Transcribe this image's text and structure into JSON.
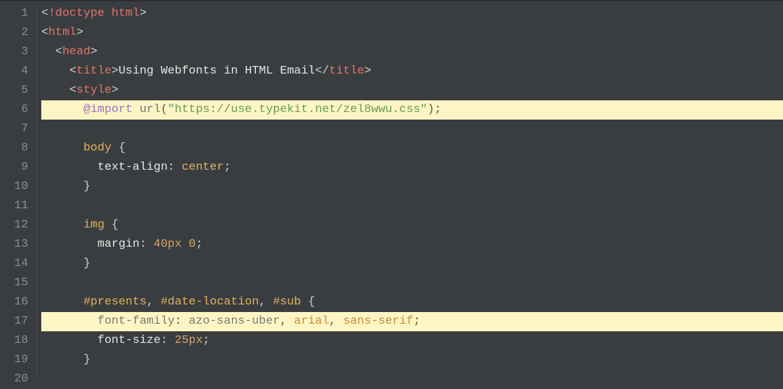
{
  "gutter": {
    "lines": [
      "1",
      "2",
      "3",
      "4",
      "5",
      "6",
      "7",
      "8",
      "9",
      "10",
      "11",
      "12",
      "13",
      "14",
      "15",
      "16",
      "17",
      "18",
      "19",
      "20"
    ]
  },
  "code": {
    "l1": {
      "doctype": "!doctype html"
    },
    "l2": {
      "tag": "html"
    },
    "l3": {
      "tag": "head"
    },
    "l4": {
      "tag_open": "title",
      "text": "Using Webfonts in HTML Email",
      "tag_close": "title"
    },
    "l5": {
      "tag": "style"
    },
    "l6": {
      "keyword": "@import",
      "func": "url",
      "string": "\"https://use.typekit.net/zel8wwu.css\"",
      "semi": ";"
    },
    "l7": {},
    "l8": {
      "selector": "body",
      "brace": "{"
    },
    "l9": {
      "prop": "text-align",
      "value": "center",
      "semi": ";"
    },
    "l10": {
      "brace": "}"
    },
    "l11": {},
    "l12": {
      "selector": "img",
      "brace": "{"
    },
    "l13": {
      "prop": "margin",
      "val1": "40px",
      "val2": "0",
      "semi": ";"
    },
    "l14": {
      "brace": "}"
    },
    "l15": {},
    "l16": {
      "sel1": "#presents",
      "sel2": "#date-location",
      "sel3": "#sub",
      "brace": "{"
    },
    "l17": {
      "prop": "font-family",
      "val1": "azo-sans-uber",
      "val2": "arial",
      "val3": "sans-serif",
      "semi": ";"
    },
    "l18": {
      "prop": "font-size",
      "val": "25px",
      "semi": ";"
    },
    "l19": {
      "brace": "}"
    }
  }
}
